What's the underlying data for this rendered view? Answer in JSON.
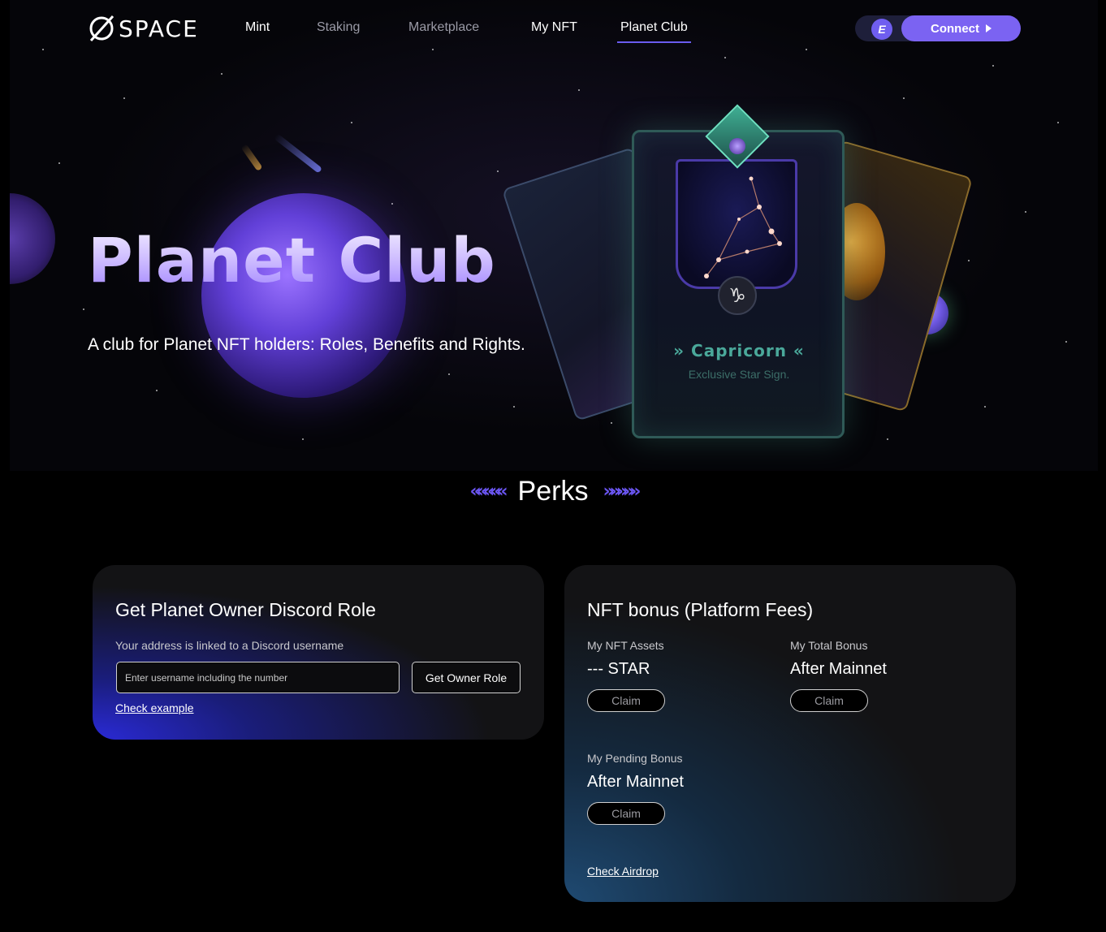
{
  "brand": {
    "logo_text": "SPACE"
  },
  "nav": {
    "items": [
      {
        "label": "Mint"
      },
      {
        "label": "Staking"
      },
      {
        "label": "Marketplace"
      },
      {
        "label": "My NFT"
      },
      {
        "label": "Planet Club"
      }
    ],
    "active": "Planet Club",
    "wallet_icon": "chain-logo-icon",
    "wallet_glyph": "E",
    "connect_label": "Connect"
  },
  "hero": {
    "title": "Planet Club",
    "subtitle": "A club for Planet NFT holders: Roles, Benefits and Rights.",
    "card": {
      "name": "Capricorn",
      "subtitle": "Exclusive Star Sign.",
      "sign_glyph": "♑"
    }
  },
  "perks": {
    "heading": "Perks",
    "discord": {
      "title": "Get Planet Owner Discord Role",
      "linked_label": "Your address is linked to a Discord username",
      "input_placeholder": "Enter username including the number",
      "input_value": "",
      "button_label": "Get Owner Role",
      "example_link": "Check example"
    },
    "bonus": {
      "title": "NFT bonus (Platform Fees)",
      "assets": {
        "label": "My NFT Assets",
        "value": "--- STAR",
        "claim_label": "Claim"
      },
      "total": {
        "label": "My Total Bonus",
        "value": "After Mainnet",
        "claim_label": "Claim"
      },
      "pending": {
        "label": "My Pending Bonus",
        "value": "After Mainnet",
        "claim_label": "Claim"
      },
      "airdrop_link": "Check Airdrop"
    }
  },
  "colors": {
    "accent": "#7b63f2",
    "nav_underline": "#6a5cf0",
    "background": "#000000",
    "panel": "#131315"
  }
}
